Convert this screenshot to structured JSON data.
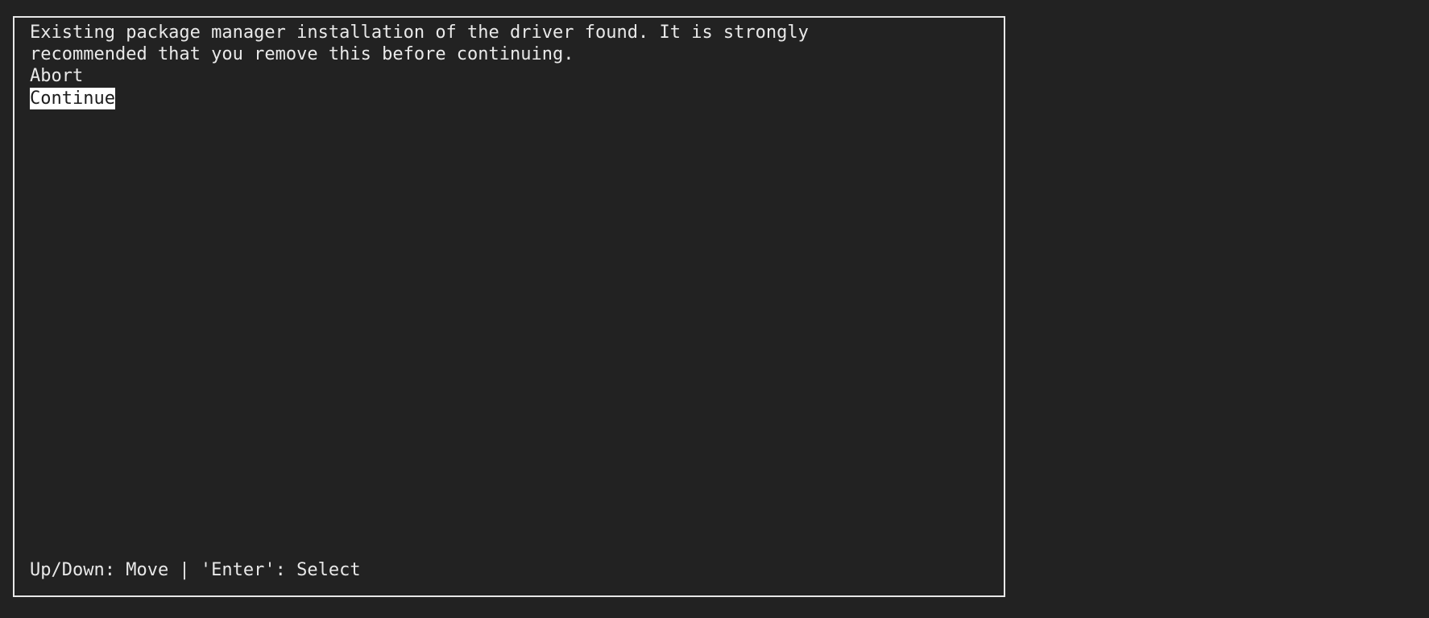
{
  "theme": {
    "background": "#222222",
    "foreground": "#e9e9e9",
    "border": "#e8e8e8",
    "selection_background": "#ffffff",
    "selection_foreground": "#1c1c1c"
  },
  "dialog": {
    "message_lines": [
      "Existing package manager installation of the driver found. It is strongly",
      "recommended that you remove this before continuing."
    ],
    "menu": {
      "items": [
        {
          "label": "Abort",
          "selected": false
        },
        {
          "label": "Continue",
          "selected": true
        }
      ]
    },
    "hint": "Up/Down: Move | 'Enter': Select"
  }
}
